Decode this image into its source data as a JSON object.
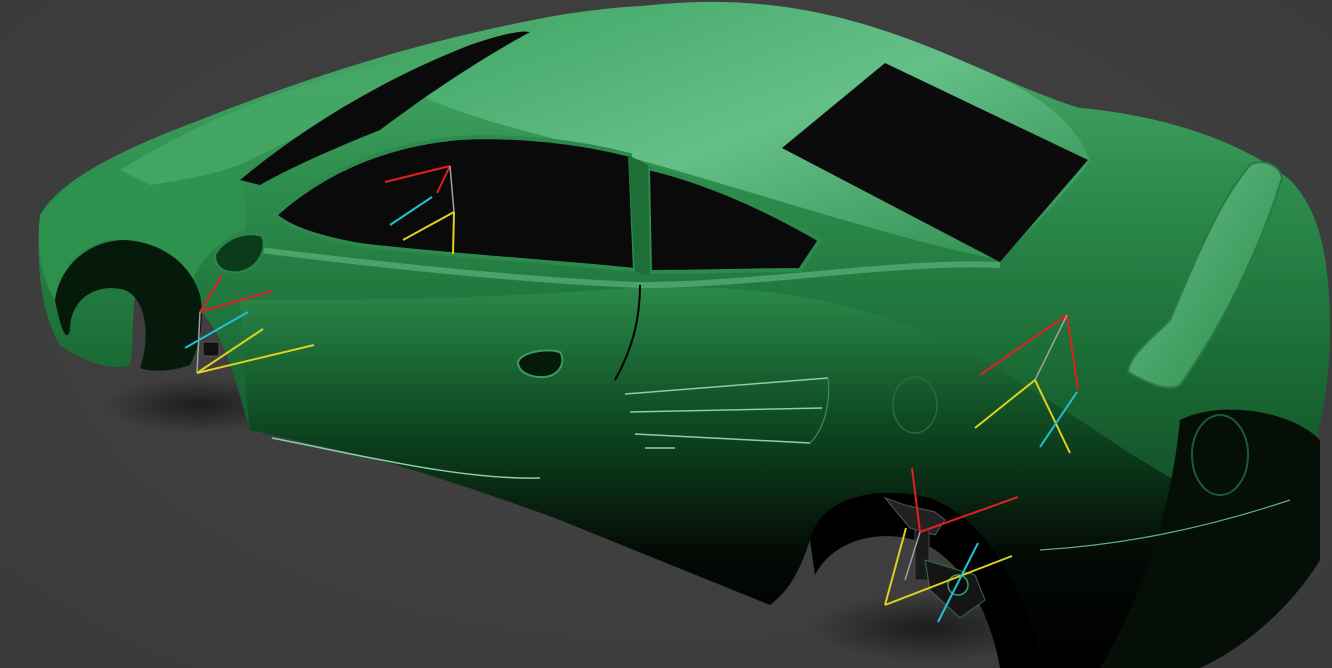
{
  "viewport": {
    "background_color": "#3f3f3f",
    "content": "3d-render"
  },
  "car": {
    "body_color": "#1f7a3c",
    "highlight_color": "#6fc08c",
    "glass_color": "#0a0a0a"
  },
  "gizmos": {
    "axis_colors": {
      "x": "#e02020",
      "y": "#e0d020",
      "z": "#20c0d8",
      "link": "#a0a0a0"
    },
    "items": [
      "front-window-gizmo",
      "front-wheel-gizmo",
      "rear-fender-gizmo",
      "rear-wheel-gizmo"
    ]
  }
}
